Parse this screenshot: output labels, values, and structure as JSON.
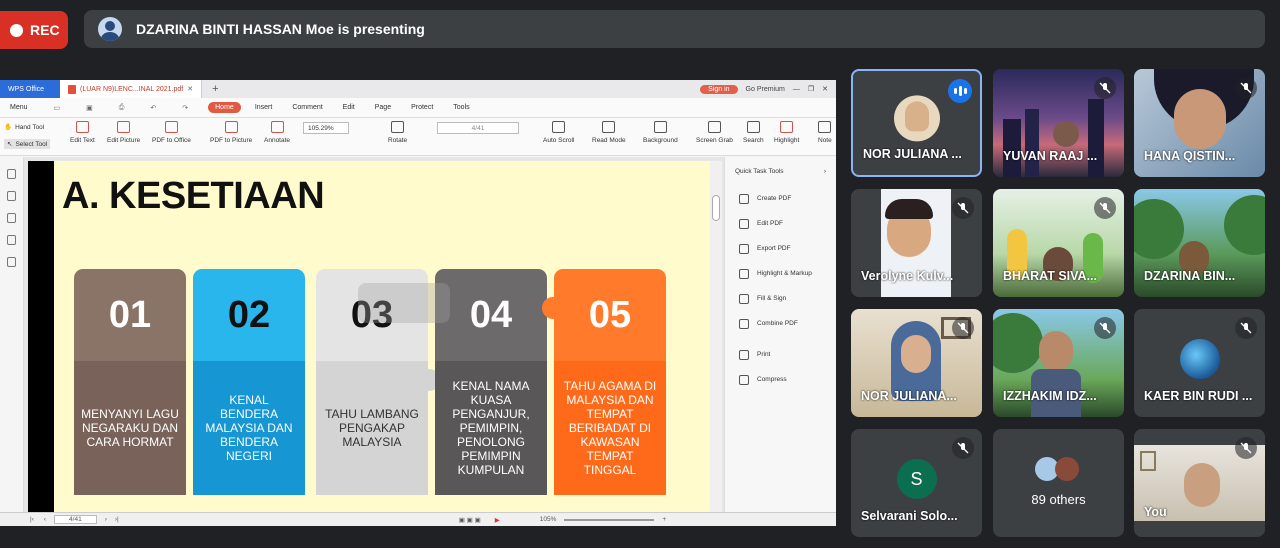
{
  "meet": {
    "rec_label": "REC",
    "presenting_text": "DZARINA BINTI HASSAN Moe is presenting"
  },
  "wps": {
    "app_tab": "WPS Office",
    "doc_tab": "(LUAR N9)LENC...INAL 2021.pdf",
    "sign_in": "Sign in",
    "go_premium": "Go Premium",
    "menu": [
      "Menu",
      "Home",
      "Insert",
      "Comment",
      "Edit",
      "Page",
      "Protect",
      "Tools"
    ],
    "hand_tool": "Hand Tool",
    "select_tool": "Select Tool",
    "ribbon": [
      "Edit Text",
      "Edit Picture",
      "PDF to Office",
      "PDF to Picture",
      "Annotate",
      "Rotate",
      "Auto Scroll",
      "Read Mode",
      "Background",
      "Screen Grab",
      "Search",
      "Highlight",
      "Note"
    ],
    "zoom": "105.29%",
    "page": "4/41",
    "status_page": "4/41",
    "status_zoom": "105%"
  },
  "slide": {
    "title": "A. KESETIAAN",
    "pieces": [
      {
        "num": "01",
        "text": "MENYANYI LAGU NEGARAKU DAN CARA HORMAT"
      },
      {
        "num": "02",
        "text": "KENAL BENDERA MALAYSIA DAN BENDERA NEGERI"
      },
      {
        "num": "03",
        "text": "TAHU LAMBANG PENGAKAP MALAYSIA"
      },
      {
        "num": "04",
        "text": "KENAL NAMA KUASA PENGANJUR, PEMIMPIN, PENOLONG PEMIMPIN KUMPULAN"
      },
      {
        "num": "05",
        "text": "TAHU AGAMA DI MALAYSIA DAN TEMPAT BERIBADAT DI KAWASAN TEMPAT TINGGAL"
      }
    ]
  },
  "quick_tools": {
    "title": "Quick Task Tools",
    "items": [
      "Create PDF",
      "Edit PDF",
      "Export PDF",
      "Highlight & Markup",
      "Fill & Sign",
      "Combine PDF",
      "Print",
      "Compress"
    ]
  },
  "participants": [
    {
      "name": "NOR JULIANA ..."
    },
    {
      "name": "YUVAN RAAJ ..."
    },
    {
      "name": "HANA QISTIN..."
    },
    {
      "name": "Verolyne Kulv..."
    },
    {
      "name": "BHARAT SIVA..."
    },
    {
      "name": "DZARINA BIN..."
    },
    {
      "name": "NOR JULIANA..."
    },
    {
      "name": "IZZHAKIM IDZ..."
    },
    {
      "name": "KAER BIN RUDI ..."
    },
    {
      "name": "Selvarani Solo...",
      "initial": "S"
    },
    {
      "name": "89 others"
    },
    {
      "name": "You"
    }
  ],
  "colors": {
    "rec": "#d93025",
    "piece1": "#8a7468",
    "piece2": "#1fa9e1",
    "piece3": "#e2e2e2",
    "piece4": "#6b6b6b",
    "piece5": "#ff6a1a"
  }
}
